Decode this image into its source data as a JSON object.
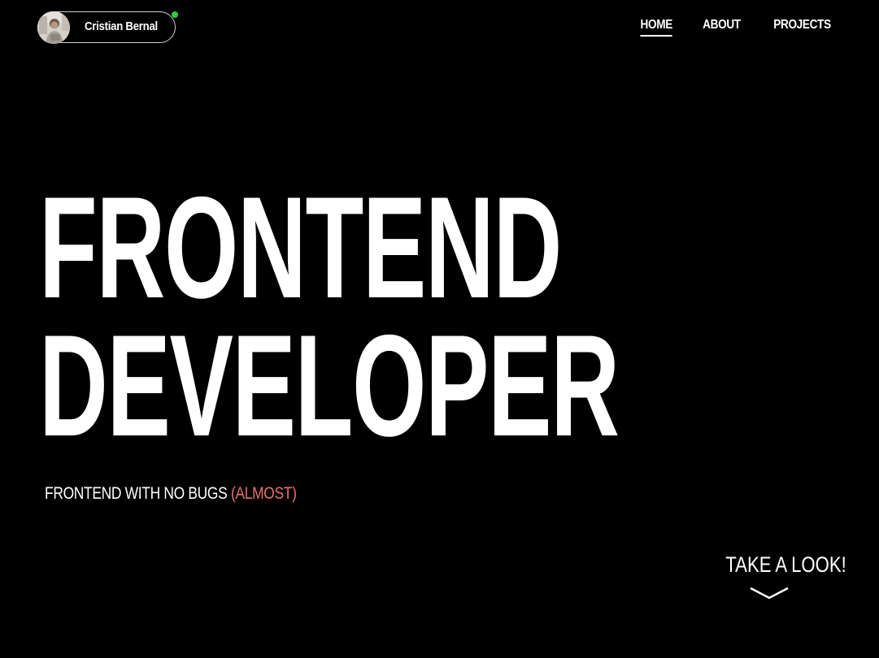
{
  "profile": {
    "name": "Cristian Bernal",
    "status_color": "#2ecc40"
  },
  "nav": {
    "items": [
      {
        "label": "HOME",
        "active": true
      },
      {
        "label": "ABOUT",
        "active": false
      },
      {
        "label": "PROJECTS",
        "active": false
      }
    ]
  },
  "hero": {
    "line1": "FRONTEND",
    "line2": "DEVELOPER",
    "subtitle_main": "FRONTEND WITH NO BUGS",
    "subtitle_accent": "(ALMOST)"
  },
  "cta": {
    "label": "TAKE A LOOK!",
    "icon": "chevron-down-icon"
  },
  "colors": {
    "background": "#000000",
    "text": "#ffffff",
    "accent": "#e8706f"
  }
}
